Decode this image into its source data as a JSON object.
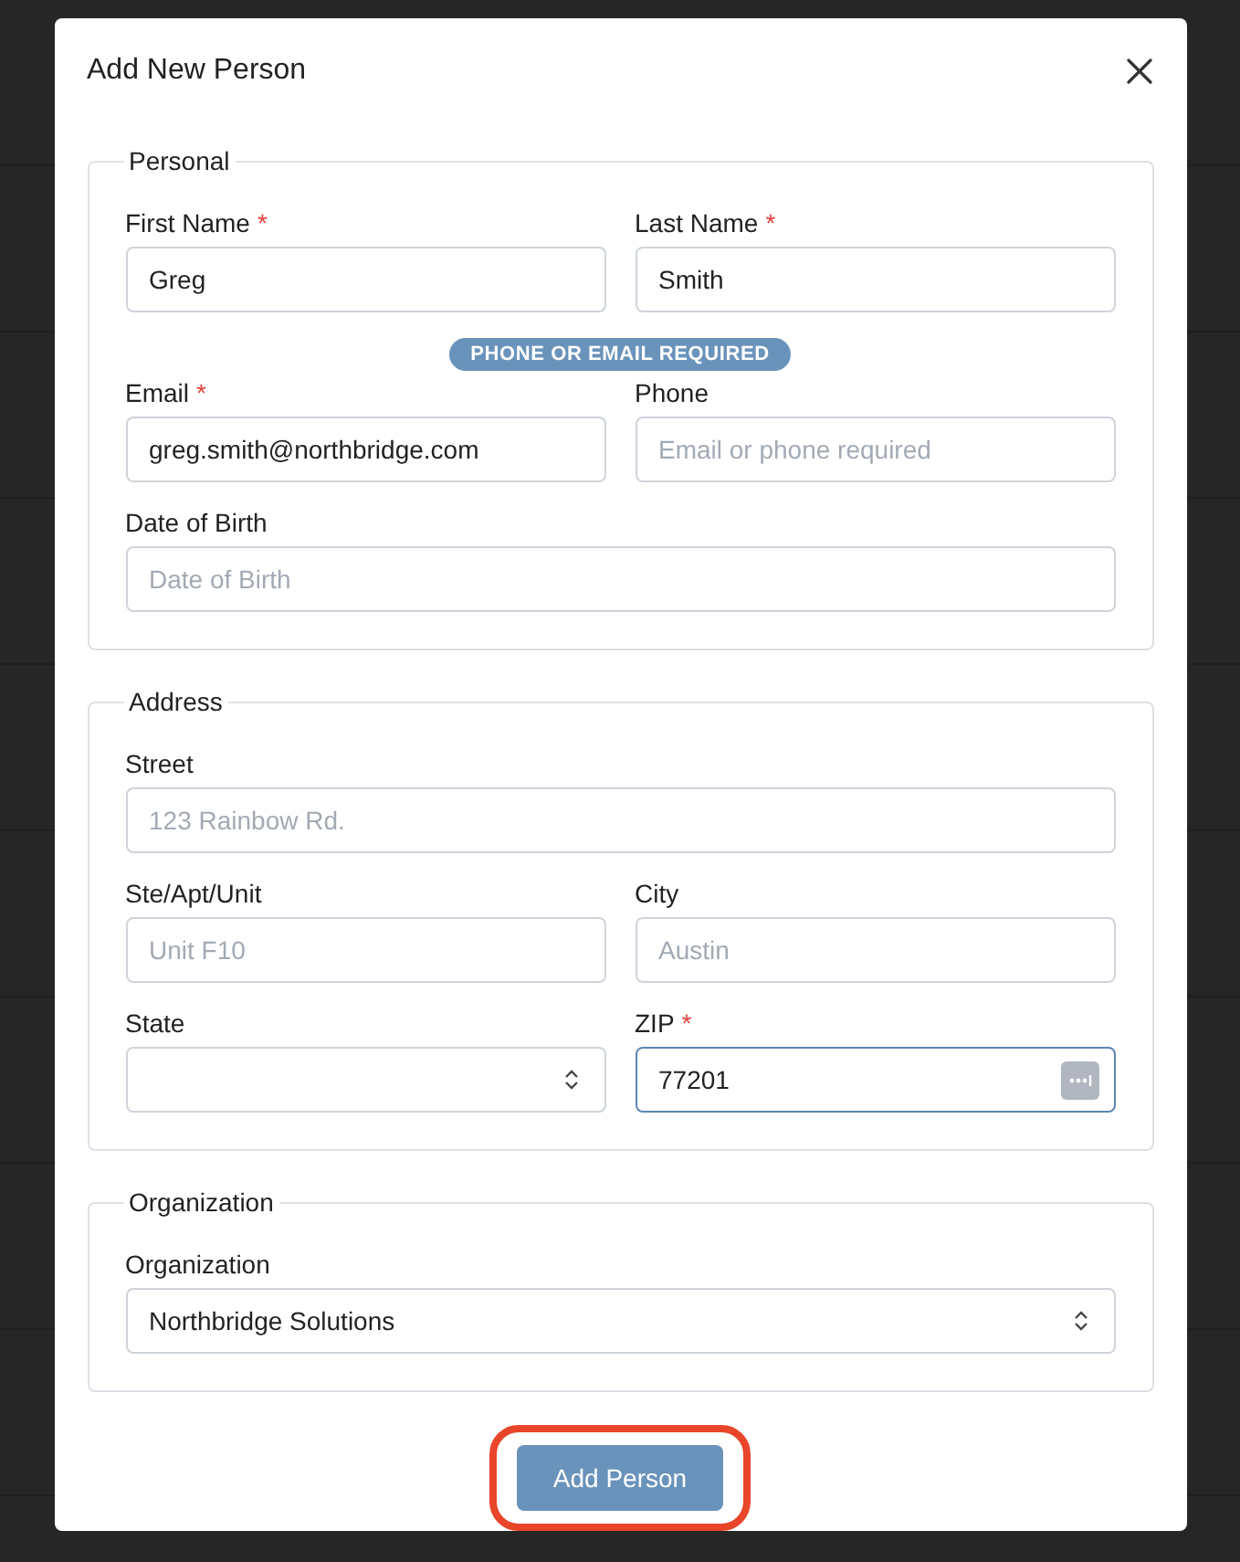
{
  "dialog": {
    "title": "Add New Person",
    "sections": [
      {
        "legend": "Personal",
        "rows": [
          {
            "kind": "fields",
            "fields": [
              {
                "label": "First Name",
                "required_mark": "*",
                "kind": "text",
                "value": "Greg",
                "focused": false
              },
              {
                "label": "Last Name",
                "required_mark": "*",
                "kind": "text",
                "value": "Smith",
                "focused": false
              }
            ]
          },
          {
            "kind": "badge",
            "text": "PHONE OR EMAIL REQUIRED"
          },
          {
            "kind": "fields",
            "fields": [
              {
                "label": "Email",
                "required_mark": "*",
                "kind": "text",
                "value": "greg.smith@northbridge.com",
                "focused": false
              },
              {
                "label": "Phone",
                "kind": "text",
                "placeholder": "Email or phone required",
                "focused": false
              }
            ]
          },
          {
            "kind": "fields",
            "fields": [
              {
                "label": "Date of Birth",
                "kind": "text",
                "placeholder": "Date of Birth",
                "focused": false
              }
            ]
          }
        ]
      },
      {
        "legend": "Address",
        "rows": [
          {
            "kind": "fields",
            "fields": [
              {
                "label": "Street",
                "kind": "text",
                "placeholder": "123 Rainbow Rd.",
                "focused": false
              }
            ]
          },
          {
            "kind": "fields",
            "fields": [
              {
                "label": "Ste/Apt/Unit",
                "kind": "text",
                "placeholder": "Unit F10",
                "focused": false
              },
              {
                "label": "City",
                "kind": "text",
                "placeholder": "Austin",
                "focused": false
              }
            ]
          },
          {
            "kind": "fields",
            "fields": [
              {
                "label": "State",
                "kind": "select",
                "focused": false
              },
              {
                "label": "ZIP",
                "required_mark": "*",
                "kind": "text",
                "value": "77201",
                "focused": true,
                "autofill": true
              }
            ]
          }
        ]
      },
      {
        "legend": "Organization",
        "rows": [
          {
            "kind": "fields",
            "fields": [
              {
                "label": "Organization",
                "kind": "select",
                "value": "Northbridge Solutions",
                "focused": false
              }
            ]
          }
        ]
      }
    ],
    "submit": {
      "label": "Add Person",
      "highlighted": true
    }
  }
}
